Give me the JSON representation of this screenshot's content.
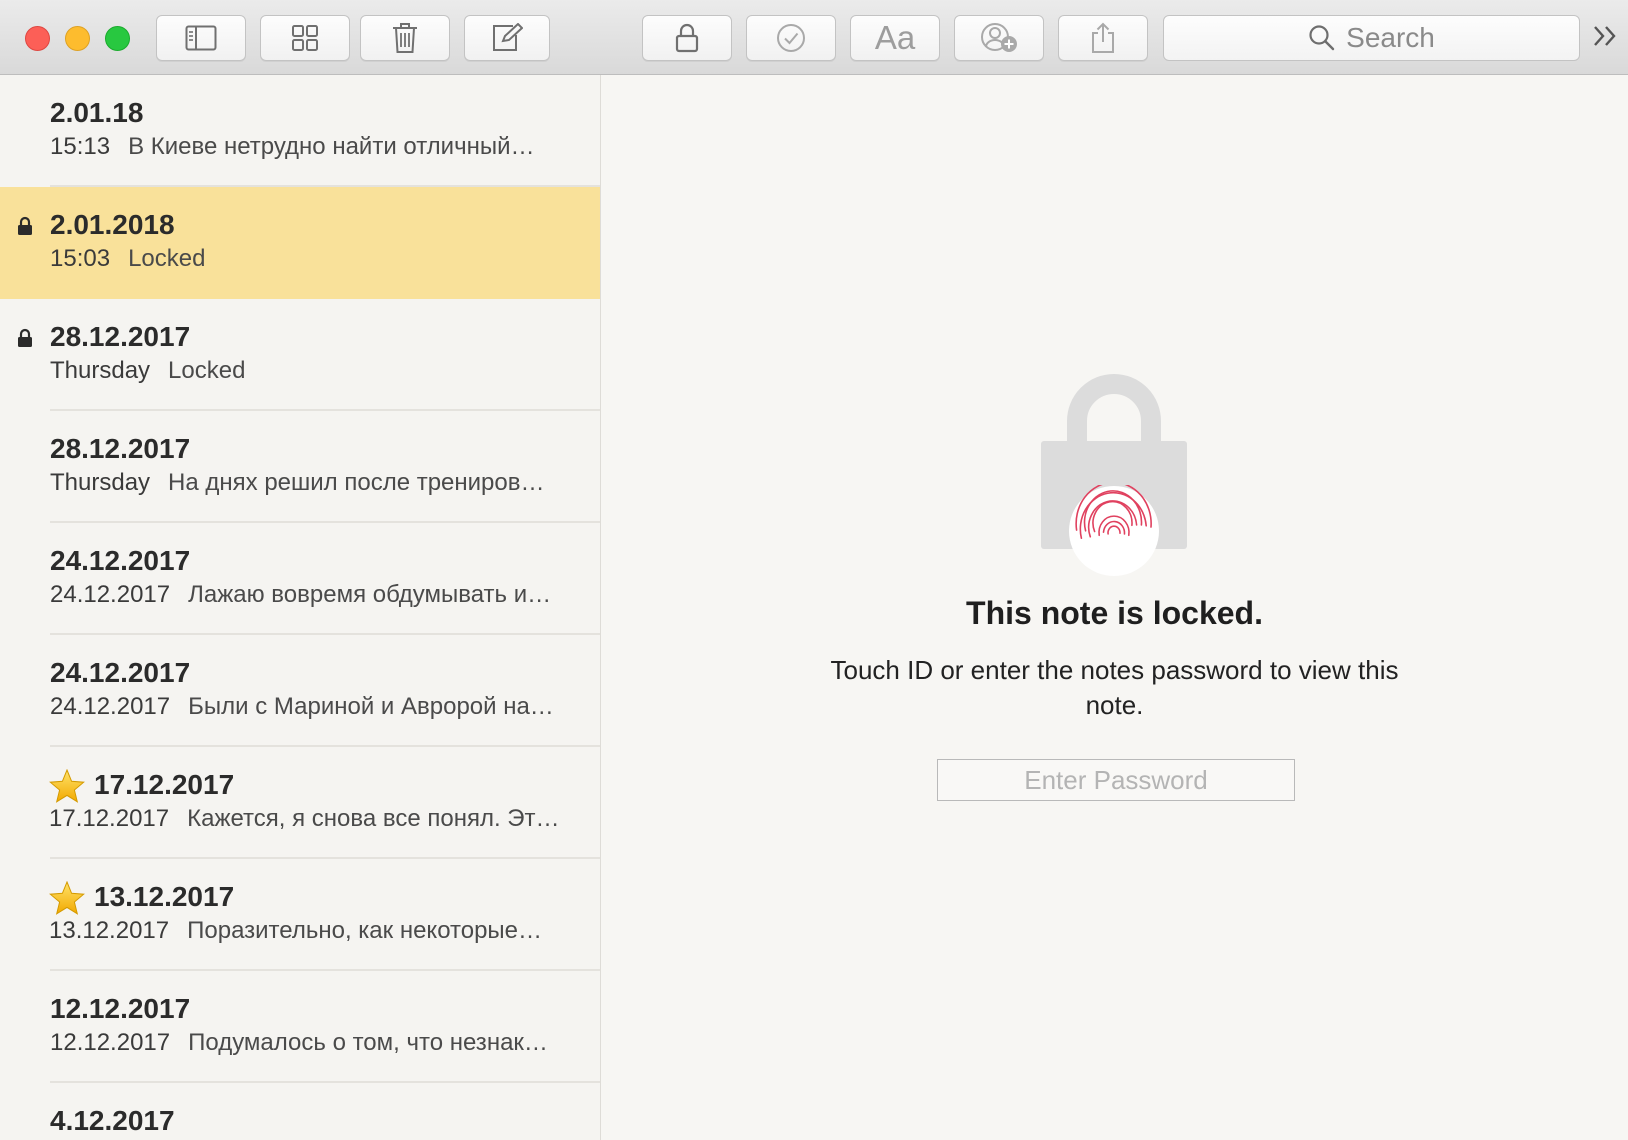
{
  "toolbar": {
    "buttons": [
      {
        "name": "toggle-sidebar-icon"
      },
      {
        "name": "attachments-grid-icon"
      },
      {
        "name": "trash-icon"
      },
      {
        "name": "compose-icon"
      },
      {
        "name": "lock-icon"
      },
      {
        "name": "checklist-icon"
      },
      {
        "name": "format-text-icon",
        "label": "Aa"
      },
      {
        "name": "add-people-icon"
      },
      {
        "name": "share-icon"
      }
    ],
    "search_placeholder": "Search"
  },
  "notes": [
    {
      "title": "2.01.18",
      "date": "15:13",
      "preview": "В Киеве нетрудно найти отличный…",
      "locked": false,
      "starred": false,
      "selected": false
    },
    {
      "title": "2.01.2018",
      "date": "15:03",
      "preview": "Locked",
      "locked": true,
      "starred": false,
      "selected": true
    },
    {
      "title": "28.12.2017",
      "date": "Thursday",
      "preview": "Locked",
      "locked": true,
      "starred": false,
      "selected": false
    },
    {
      "title": "28.12.2017",
      "date": "Thursday",
      "preview": "На днях решил после трениров…",
      "locked": false,
      "starred": false,
      "selected": false
    },
    {
      "title": "24.12.2017",
      "date": "24.12.2017",
      "preview": "Лажаю вовремя обдумывать и…",
      "locked": false,
      "starred": false,
      "selected": false
    },
    {
      "title": "24.12.2017",
      "date": "24.12.2017",
      "preview": "Были с Мариной и Авророй на…",
      "locked": false,
      "starred": false,
      "selected": false
    },
    {
      "title": "17.12.2017",
      "date": "17.12.2017",
      "preview": "Кажется, я снова все понял. Эт…",
      "locked": false,
      "starred": true,
      "selected": false
    },
    {
      "title": "13.12.2017",
      "date": "13.12.2017",
      "preview": "Поразительно, как некоторые…",
      "locked": false,
      "starred": true,
      "selected": false
    },
    {
      "title": "12.12.2017",
      "date": "12.12.2017",
      "preview": "Подумалось о том, что незнак…",
      "locked": false,
      "starred": false,
      "selected": false
    },
    {
      "title": "4.12.2017",
      "date": "",
      "preview": "",
      "locked": false,
      "starred": false,
      "selected": false
    }
  ],
  "locked_view": {
    "title": "This note is locked.",
    "message": "Touch ID or enter the notes password to view this note.",
    "password_placeholder": "Enter Password",
    "fingerprint_color": "#e0415f"
  },
  "colors": {
    "selected_row": "#f9e19a",
    "close": "#fc5f57",
    "minimize": "#fdbc2e",
    "maximize": "#28c840"
  }
}
